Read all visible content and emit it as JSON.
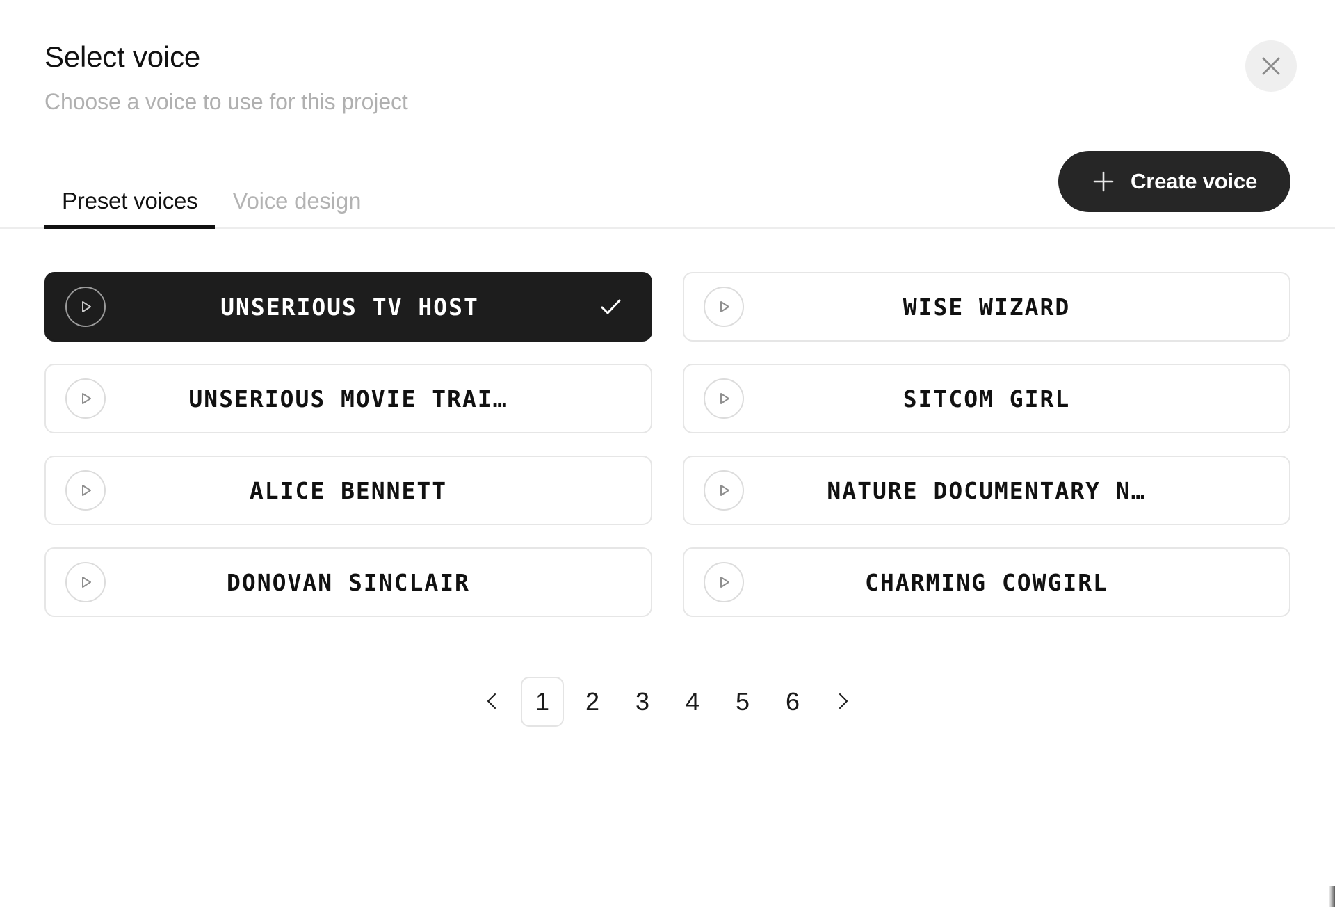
{
  "modal": {
    "title": "Select voice",
    "subtitle": "Choose a voice to use for this project",
    "close_icon": "close-icon"
  },
  "tabs": [
    {
      "label": "Preset voices",
      "active": true
    },
    {
      "label": "Voice design",
      "active": false
    }
  ],
  "toolbar": {
    "create_voice_label": "Create voice",
    "plus_icon": "plus-icon"
  },
  "voices": [
    {
      "name": "UNSERIOUS TV HOST",
      "selected": true,
      "play_icon": "play-icon",
      "check_icon": "check-icon"
    },
    {
      "name": "WISE WIZARD",
      "selected": false,
      "play_icon": "play-icon"
    },
    {
      "name": "UNSERIOUS MOVIE TRAI…",
      "selected": false,
      "play_icon": "play-icon"
    },
    {
      "name": "SITCOM GIRL",
      "selected": false,
      "play_icon": "play-icon"
    },
    {
      "name": "ALICE BENNETT",
      "selected": false,
      "play_icon": "play-icon"
    },
    {
      "name": "NATURE DOCUMENTARY N…",
      "selected": false,
      "play_icon": "play-icon"
    },
    {
      "name": "DONOVAN SINCLAIR",
      "selected": false,
      "play_icon": "play-icon"
    },
    {
      "name": "CHARMING COWGIRL",
      "selected": false,
      "play_icon": "play-icon"
    }
  ],
  "pagination": {
    "prev_icon": "chevron-left-icon",
    "next_icon": "chevron-right-icon",
    "pages": [
      "1",
      "2",
      "3",
      "4",
      "5",
      "6"
    ],
    "current": "1"
  },
  "colors": {
    "accent_dark": "#262626",
    "selected_card": "#1d1d1d",
    "card_border": "#e6e6e6",
    "muted_text": "#b3b3b3",
    "close_bg": "#efefef"
  }
}
